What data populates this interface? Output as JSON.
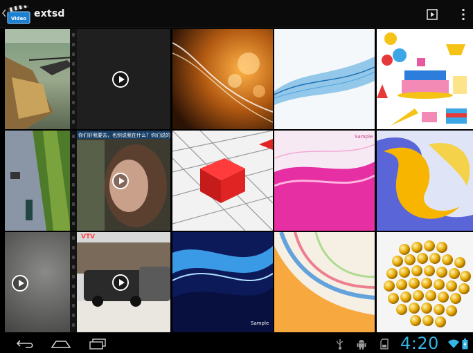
{
  "action_bar": {
    "title": "extsd",
    "app_icon_text": "Video",
    "icons": [
      "up-caret-icon",
      "gallery-app-icon",
      "slideshow-icon",
      "overflow-menu-icon"
    ]
  },
  "grid": {
    "tiles": [
      {
        "kind": "image",
        "subject": "helicopter"
      },
      {
        "kind": "video",
        "subject": "dark"
      },
      {
        "kind": "image",
        "subject": "amber-bokeh"
      },
      {
        "kind": "image",
        "subject": "blue-wave"
      },
      {
        "kind": "image",
        "subject": "birthday-cake"
      },
      {
        "kind": "image",
        "subject": "roadside"
      },
      {
        "kind": "video",
        "subject": "woman",
        "caption": "你们好我要去，也别说我在什么？你们说的我个人"
      },
      {
        "kind": "image",
        "subject": "red-cube"
      },
      {
        "kind": "image",
        "subject": "pink-swirl",
        "caption": "Sample"
      },
      {
        "kind": "image",
        "subject": "yellow-3d"
      },
      {
        "kind": "video",
        "subject": "grey-blur"
      },
      {
        "kind": "video",
        "subject": "street-cars",
        "caption": "VTV"
      },
      {
        "kind": "image",
        "subject": "blue-stripes",
        "caption": "Sample"
      },
      {
        "kind": "image",
        "subject": "rainbow-swirl"
      },
      {
        "kind": "image",
        "subject": "gold-spheres"
      }
    ]
  },
  "nav_bar": {
    "buttons": [
      "back-icon",
      "home-icon",
      "recent-apps-icon"
    ],
    "status_icons": [
      "usb-icon",
      "android-debug-icon",
      "sd-card-icon",
      "wifi-icon",
      "battery-icon"
    ],
    "clock": "4:20"
  },
  "colors": {
    "accent": "#33b5e5",
    "bar_background": "#0b0b0b"
  }
}
